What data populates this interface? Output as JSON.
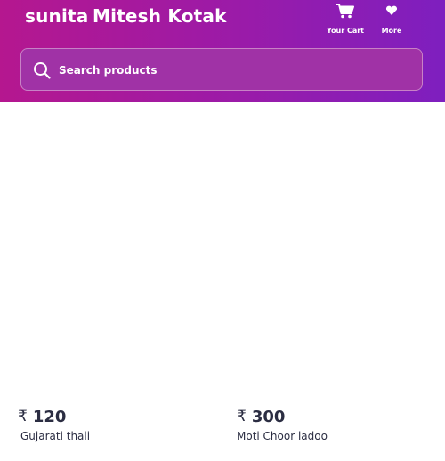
{
  "header": {
    "brand_sub": "sunita",
    "brand_title": "Mitesh Kotak",
    "nav": [
      {
        "label": "Your Cart",
        "icon": "cart-icon"
      },
      {
        "label": "More",
        "icon": "heart-icon"
      }
    ],
    "gradient": [
      "#b5178f",
      "#7e1fbf"
    ]
  },
  "search": {
    "placeholder": "Search products",
    "value": ""
  },
  "products": [
    {
      "currency": "₹",
      "price": "120",
      "name": "Gujarati thali"
    },
    {
      "currency": "₹",
      "price": "300",
      "name": "Moti Choor ladoo"
    }
  ]
}
